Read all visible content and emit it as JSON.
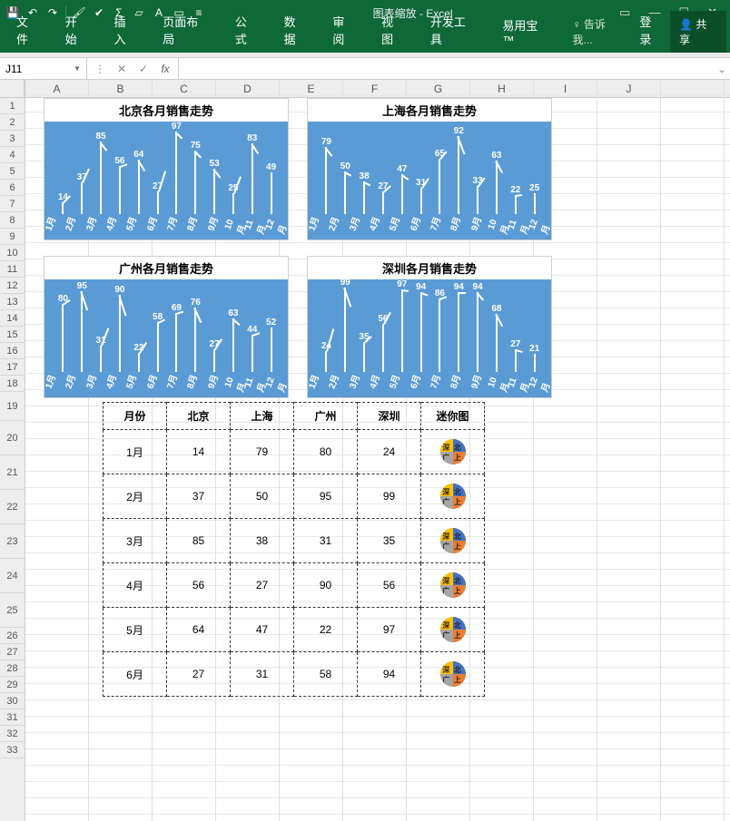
{
  "title": "图表缩放 - Excel",
  "qat": {
    "save": "💾",
    "undo": "↶",
    "redo": "↷"
  },
  "ribbon_tabs": [
    "文件",
    "开始",
    "插入",
    "页面布局",
    "公式",
    "数据",
    "审阅",
    "视图",
    "开发工具",
    "易用宝 ™"
  ],
  "tell_me": "♀ 告诉我...",
  "login": "登录",
  "share": "共享",
  "namebox": "J11",
  "formula": "",
  "columns": [
    "A",
    "B",
    "C",
    "D",
    "E",
    "F",
    "G",
    "H",
    "I",
    "J"
  ],
  "row_count": 33,
  "chart_data": [
    {
      "title": "北京各月销售走势",
      "type": "line",
      "categories": [
        "1月",
        "2月",
        "3月",
        "4月",
        "5月",
        "6月",
        "7月",
        "8月",
        "9月",
        "10月",
        "11月",
        "12月"
      ],
      "values": [
        14,
        37,
        85,
        56,
        64,
        27,
        97,
        75,
        53,
        25,
        83,
        49
      ]
    },
    {
      "title": "上海各月销售走势",
      "type": "line",
      "categories": [
        "1月",
        "2月",
        "3月",
        "4月",
        "5月",
        "6月",
        "7月",
        "8月",
        "9月",
        "10月",
        "11月",
        "12月"
      ],
      "values": [
        79,
        50,
        38,
        27,
        47,
        31,
        65,
        92,
        33,
        63,
        22,
        25
      ]
    },
    {
      "title": "广州各月销售走势",
      "type": "line",
      "categories": [
        "1月",
        "2月",
        "3月",
        "4月",
        "5月",
        "6月",
        "7月",
        "8月",
        "9月",
        "10月",
        "11月",
        "12月"
      ],
      "values": [
        80,
        95,
        31,
        90,
        22,
        58,
        69,
        76,
        27,
        63,
        44,
        52
      ]
    },
    {
      "title": "深圳各月销售走势",
      "type": "line",
      "categories": [
        "1月",
        "2月",
        "3月",
        "4月",
        "5月",
        "6月",
        "7月",
        "8月",
        "9月",
        "10月",
        "11月",
        "12月"
      ],
      "values": [
        24,
        99,
        35,
        56,
        97,
        94,
        86,
        94,
        94,
        68,
        27,
        21
      ]
    }
  ],
  "chart_pos": [
    {
      "l": 20,
      "t": 0
    },
    {
      "l": 310,
      "t": 0
    },
    {
      "l": 20,
      "t": 174
    },
    {
      "l": 310,
      "t": 174
    }
  ],
  "table": {
    "headers": [
      "月份",
      "北京",
      "上海",
      "广州",
      "深圳",
      "迷你图"
    ],
    "rows": [
      {
        "m": "1月",
        "v": [
          14,
          79,
          80,
          24
        ]
      },
      {
        "m": "2月",
        "v": [
          37,
          50,
          95,
          99
        ]
      },
      {
        "m": "3月",
        "v": [
          85,
          38,
          31,
          35
        ]
      },
      {
        "m": "4月",
        "v": [
          56,
          27,
          90,
          56
        ]
      },
      {
        "m": "5月",
        "v": [
          64,
          47,
          22,
          97
        ]
      },
      {
        "m": "6月",
        "v": [
          27,
          31,
          58,
          94
        ]
      }
    ],
    "spark_labels": [
      "北",
      "上",
      "广",
      "深"
    ],
    "spark_colors": [
      "#4472c4",
      "#ed7d31",
      "#a5a5a5",
      "#ffc000"
    ]
  }
}
